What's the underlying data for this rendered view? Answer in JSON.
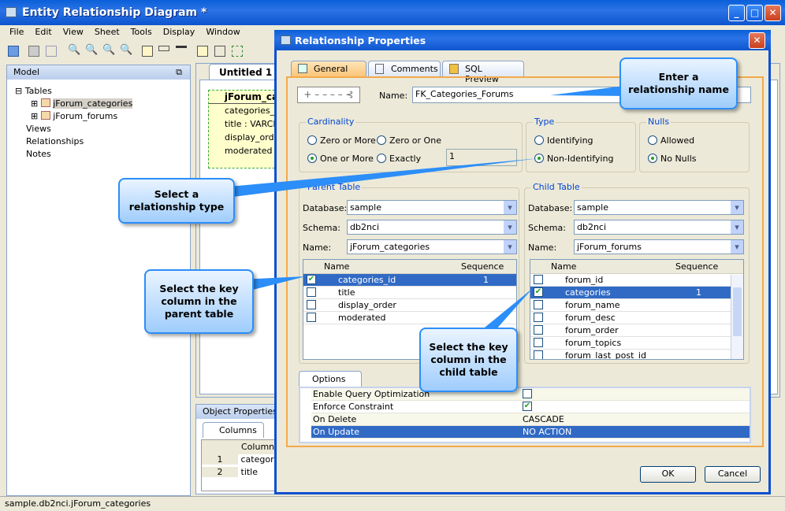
{
  "app": {
    "title": "Entity Relationship Diagram *",
    "menu": [
      "File",
      "Edit",
      "View",
      "Sheet",
      "Tools",
      "Display",
      "Window"
    ],
    "status": "sample.db2nci.jForum_categories"
  },
  "model": {
    "title": "Model",
    "tree": [
      {
        "label": "Tables"
      },
      {
        "label": "jForum_categories"
      },
      {
        "label": "jForum_forums"
      },
      {
        "label": "Views"
      },
      {
        "label": "Relationships"
      },
      {
        "label": "Notes"
      }
    ]
  },
  "canvas": {
    "tab": "Untitled 1",
    "entity": {
      "name": "jForum_ca",
      "columns": [
        "categories_id",
        "title : VARCHA",
        "display_order",
        "moderated : I"
      ]
    }
  },
  "objprops": {
    "title": "Object Properties",
    "tab": "Columns",
    "header": "Column",
    "rows": [
      [
        "1",
        "categorie"
      ],
      [
        "2",
        "title"
      ]
    ]
  },
  "dialog": {
    "title": "Relationship Properties",
    "tabs": [
      "General",
      "Comments",
      "SQL Preview"
    ],
    "name_label": "Name:",
    "name_value": "FK_Categories_Forums",
    "cardinality": {
      "label": "Cardinality",
      "options": [
        "Zero or More",
        "Zero or One",
        "One or More",
        "Exactly"
      ],
      "selected": "One or More",
      "exactly_value": "1"
    },
    "type": {
      "label": "Type",
      "options": [
        "Identifying",
        "Non-Identifying"
      ],
      "selected": "Non-Identifying"
    },
    "nulls": {
      "label": "Nulls",
      "options": [
        "Allowed",
        "No Nulls"
      ],
      "selected": "No Nulls"
    },
    "parent": {
      "label": "Parent Table",
      "database_label": "Database:",
      "database": "sample",
      "schema_label": "Schema:",
      "schema": "db2nci",
      "name_label": "Name:",
      "name": "jForum_categories",
      "cols": [
        "Name",
        "Sequence"
      ],
      "rows": [
        {
          "name": "categories_id",
          "checked": true,
          "seq": "1"
        },
        {
          "name": "title",
          "checked": false,
          "seq": ""
        },
        {
          "name": "display_order",
          "checked": false,
          "seq": ""
        },
        {
          "name": "moderated",
          "checked": false,
          "seq": ""
        }
      ]
    },
    "child": {
      "label": "Child Table",
      "database_label": "Database:",
      "database": "sample",
      "schema_label": "Schema:",
      "schema": "db2nci",
      "name_label": "Name:",
      "name": "jForum_forums",
      "cols": [
        "Name",
        "Sequence"
      ],
      "rows": [
        {
          "name": "forum_id",
          "checked": false,
          "seq": ""
        },
        {
          "name": "categories",
          "checked": true,
          "seq": "1"
        },
        {
          "name": "forum_name",
          "checked": false,
          "seq": ""
        },
        {
          "name": "forum_desc",
          "checked": false,
          "seq": ""
        },
        {
          "name": "forum_order",
          "checked": false,
          "seq": ""
        },
        {
          "name": "forum_topics",
          "checked": false,
          "seq": ""
        },
        {
          "name": "forum_last_post_id",
          "checked": false,
          "seq": ""
        }
      ]
    },
    "options": {
      "tab": "Options",
      "rows": [
        {
          "label": "Enable Query Optimization",
          "value": "",
          "checkbox": false
        },
        {
          "label": "Enforce Constraint",
          "value": "",
          "checkbox": true
        },
        {
          "label": "On Delete",
          "value": "CASCADE"
        },
        {
          "label": "On Update",
          "value": "NO ACTION"
        }
      ]
    },
    "ok": "OK",
    "cancel": "Cancel"
  },
  "callouts": {
    "name": "Enter a relationship name",
    "type": "Select a relationship type",
    "parent": "Select the key column in the parent table",
    "child": "Select the key column in the child table"
  },
  "colors": {
    "accent": "#316ac5",
    "titlebar": "#0a5fd8",
    "callout_border": "#2c8ef8",
    "tab_active": "#fbc57a"
  }
}
